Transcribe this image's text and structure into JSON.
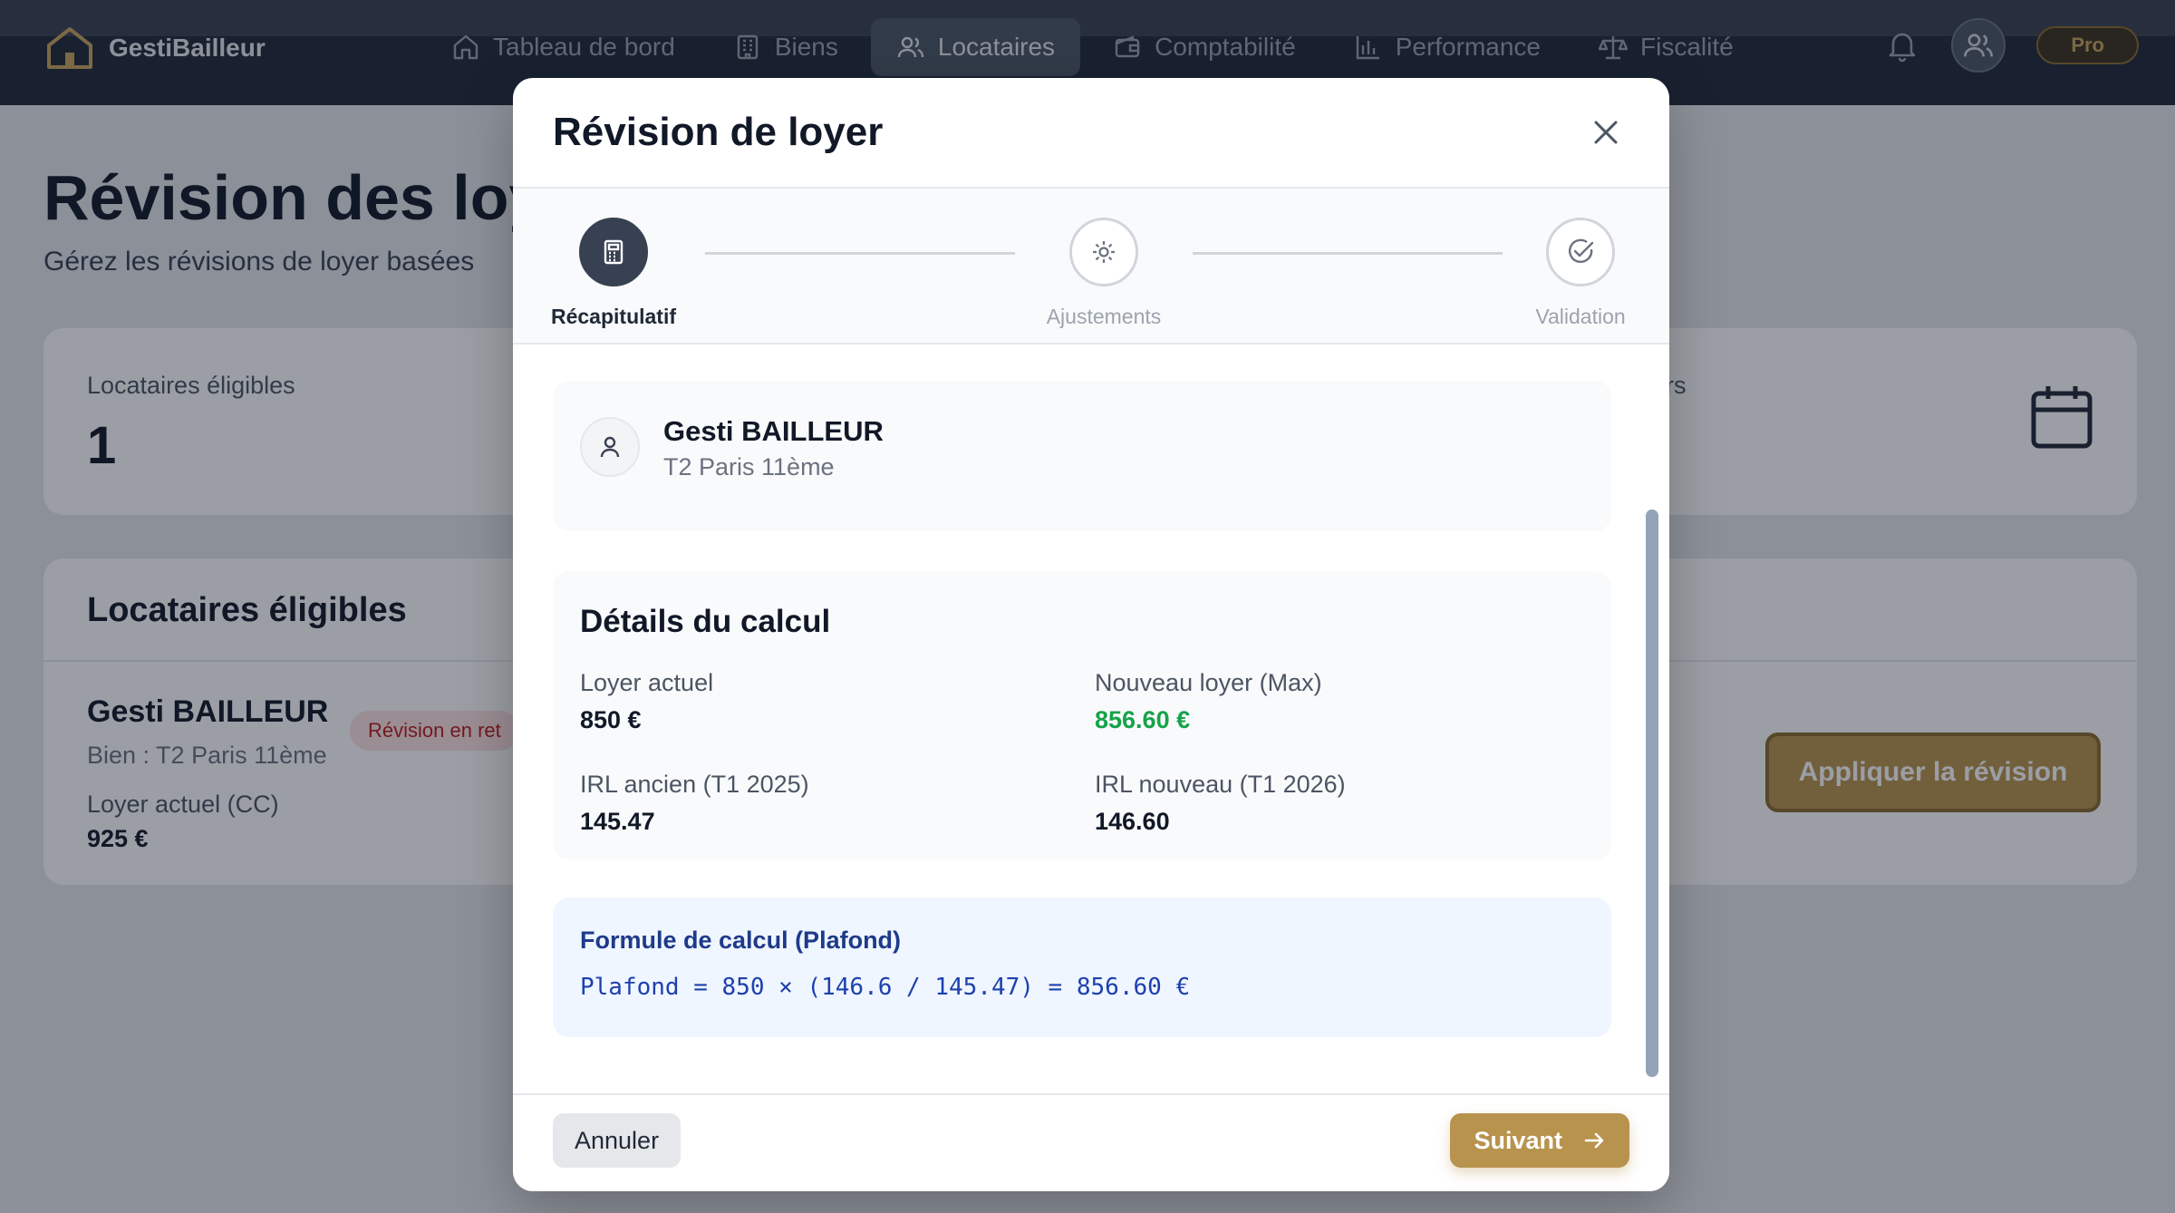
{
  "app": {
    "name": "GestiBailleur"
  },
  "nav": {
    "items": [
      {
        "label": "Tableau de bord",
        "icon": "home-icon"
      },
      {
        "label": "Biens",
        "icon": "building-icon"
      },
      {
        "label": "Locataires",
        "icon": "users-icon"
      },
      {
        "label": "Comptabilité",
        "icon": "wallet-icon"
      },
      {
        "label": "Performance",
        "icon": "bar-chart-icon"
      },
      {
        "label": "Fiscalité",
        "icon": "scale-icon"
      }
    ],
    "active": "Locataires",
    "badge": "Pro"
  },
  "page": {
    "title": "Révision des loy",
    "subtitle": "Gérez les révisions de loyer basées",
    "stats": {
      "eligible_label": "Locataires éligibles",
      "eligible_value": "1",
      "second_label_fragment": "rs"
    },
    "list": {
      "title": "Locataires éligibles",
      "tenant": {
        "name": "Gesti BAILLEUR",
        "badge": "Révision en ret",
        "property": "Bien : T2 Paris 11ème",
        "rent_label": "Loyer actuel (CC)",
        "rent_value": "925 €"
      },
      "apply_label": "Appliquer la révision"
    }
  },
  "modal": {
    "title": "Révision de loyer",
    "steps": [
      {
        "label": "Récapitulatif",
        "icon": "calculator-icon",
        "active": true
      },
      {
        "label": "Ajustements",
        "icon": "gear-icon",
        "active": false
      },
      {
        "label": "Validation",
        "icon": "check-circle-icon",
        "active": false
      }
    ],
    "tenant": {
      "name": "Gesti BAILLEUR",
      "property": "T2 Paris 11ème"
    },
    "calc": {
      "title": "Détails du calcul",
      "current_rent_label": "Loyer actuel",
      "current_rent_value": "850 €",
      "new_rent_label": "Nouveau loyer (Max)",
      "new_rent_value": "856.60 €",
      "irl_old_label": "IRL ancien (T1 2025)",
      "irl_old_value": "145.47",
      "irl_new_label": "IRL nouveau (T1 2026)",
      "irl_new_value": "146.60"
    },
    "formula": {
      "title": "Formule de calcul (Plafond)",
      "text": "Plafond = 850 × (146.6 / 145.47) = 856.60 €"
    },
    "footer": {
      "cancel_label": "Annuler",
      "next_label": "Suivant"
    }
  },
  "colors": {
    "accent": "#b8934d",
    "nav_bg": "#1f2937",
    "success": "#16a34a",
    "formula_bg": "#eff6ff",
    "formula_text": "#1e40af"
  }
}
